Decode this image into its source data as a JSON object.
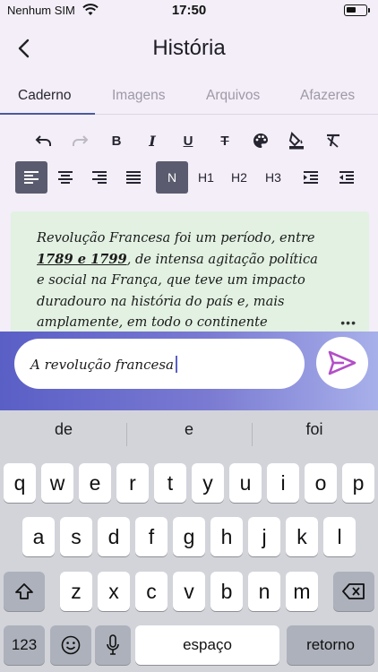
{
  "status_bar": {
    "carrier": "Nenhum SIM",
    "time": "17:50"
  },
  "header": {
    "title": "História",
    "back_icon": "chevron-left-icon"
  },
  "tabs": [
    {
      "label": "Caderno",
      "active": true
    },
    {
      "label": "Imagens",
      "active": false
    },
    {
      "label": "Arquivos",
      "active": false
    },
    {
      "label": "Afazeres",
      "active": false
    }
  ],
  "toolbar": {
    "row1": [
      "undo-icon",
      "redo-icon",
      "bold-icon",
      "italic-icon",
      "underline-icon",
      "strikethrough-icon",
      "palette-icon",
      "fill-color-icon",
      "clear-format-icon"
    ],
    "row2_text": {
      "normal": "N",
      "h1": "H1",
      "h2": "H2",
      "h3": "H3"
    }
  },
  "note": {
    "line1": "Revolução Francesa foi um período, entre",
    "years": "1789 e 1799",
    "line2_rest": ", de intensa agitação política",
    "line3": "e social na França, que teve um impacto",
    "line4": "duradouro na história do país e, mais",
    "line5": "amplamente, em todo o continente",
    "more": "•••"
  },
  "composer": {
    "value": "A revolução francesa",
    "send_icon": "send-icon"
  },
  "keyboard": {
    "suggestions": [
      "de",
      "e",
      "foi"
    ],
    "row1": [
      "q",
      "w",
      "e",
      "r",
      "t",
      "y",
      "u",
      "i",
      "o",
      "p"
    ],
    "row2": [
      "a",
      "s",
      "d",
      "f",
      "g",
      "h",
      "j",
      "k",
      "l"
    ],
    "row3": [
      "z",
      "x",
      "c",
      "v",
      "b",
      "n",
      "m"
    ],
    "numbers": "123",
    "space": "espaço",
    "return": "retorno"
  },
  "colors": {
    "accent": "#4a5a9c",
    "note_bg": "#e2f1e2",
    "send_arrow": "#b24fc7"
  }
}
